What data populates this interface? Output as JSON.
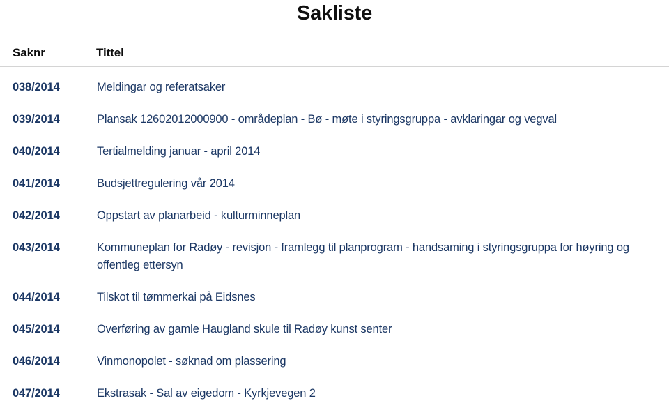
{
  "document": {
    "title": "Sakliste"
  },
  "table": {
    "columns": [
      {
        "key": "saknr",
        "label": "Saknr"
      },
      {
        "key": "tittel",
        "label": "Tittel"
      }
    ],
    "rows": [
      {
        "saknr": "038/2014",
        "tittel": "Meldingar og referatsaker"
      },
      {
        "saknr": "039/2014",
        "tittel": "Plansak 12602012000900 - områdeplan - Bø - møte i styringsgruppa - avklaringar og vegval"
      },
      {
        "saknr": "040/2014",
        "tittel": "Tertialmelding januar - april 2014"
      },
      {
        "saknr": "041/2014",
        "tittel": "Budsjettregulering vår 2014"
      },
      {
        "saknr": "042/2014",
        "tittel": "Oppstart av planarbeid - kulturminneplan"
      },
      {
        "saknr": "043/2014",
        "tittel": "Kommuneplan for Radøy - revisjon - framlegg til planprogram - handsaming i styringsgruppa for høyring og offentleg ettersyn"
      },
      {
        "saknr": "044/2014",
        "tittel": "Tilskot til tømmerkai på Eidsnes"
      },
      {
        "saknr": "045/2014",
        "tittel": "Overføring av gamle Haugland skule til Radøy kunst senter"
      },
      {
        "saknr": "046/2014",
        "tittel": "Vinmonopolet - søknad om plassering"
      },
      {
        "saknr": "047/2014",
        "tittel": "Ekstrasak - Sal av eigedom - Kyrkjevegen 2"
      }
    ]
  },
  "colors": {
    "title_text": "#101010",
    "header_text": "#0d0d0d",
    "row_text": "#1b3764",
    "rule": "#d4d4d4",
    "background": "#ffffff"
  }
}
